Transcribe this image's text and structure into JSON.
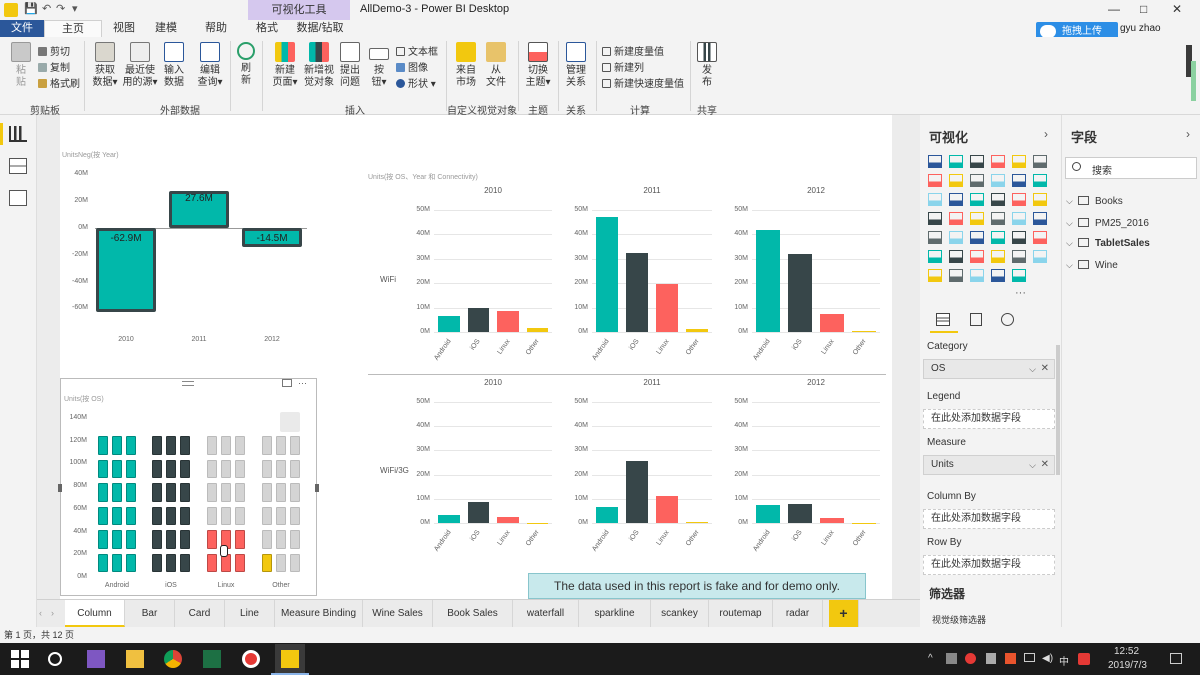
{
  "window": {
    "title": "AllDemo-3 - Power BI Desktop",
    "context_tab": "可视化工具",
    "minimize": "—",
    "maximize": "□",
    "close": "✕"
  },
  "quick_access": [
    "💾",
    "↶",
    "↷",
    "▾"
  ],
  "upload_label": "拖拽上传",
  "user_name": "gyu zhao",
  "tabs": [
    "文件",
    "主页",
    "视图",
    "建模",
    "帮助",
    "格式",
    "数据/钻取"
  ],
  "ribbon": {
    "paste": "粘\n贴",
    "cut": "剪切",
    "copy": "复制",
    "format_painter": "格式刷",
    "get_data": "获取\n数据▾",
    "recent": "最近使\n用的源▾",
    "enter_data": "输入\n数据",
    "edit_queries": "编辑\n查询▾",
    "refresh": "刷\n新",
    "new_page": "新建\n页面▾",
    "new_visual": "新增视\n觉对象",
    "ask": "提出\n问题",
    "buttons": "按\n钮▾",
    "textbox": "文本框",
    "image": "图像",
    "shapes": "形状 ▾",
    "from_market": "来自\n市场",
    "from_file": "从\n文件",
    "switch_theme": "切换\n主题▾",
    "manage_rel": "管理\n关系",
    "new_measure": "新建度量值",
    "new_column": "新建列",
    "new_quick_measure": "新建快速度量值",
    "publish": "发\n布",
    "groups": [
      "剪贴板",
      "外部数据",
      "插入",
      "自定义视觉对象",
      "主题",
      "关系",
      "计算",
      "共享"
    ]
  },
  "chart1": {
    "title": "UnitsNeg(按 Year)",
    "y_ticks": [
      "40M",
      "20M",
      "0M",
      "-20M",
      "-40M",
      "-60M"
    ],
    "chart_data": {
      "type": "bar",
      "categories": [
        "2010",
        "2011",
        "2012"
      ],
      "values": [
        -62.9,
        27.6,
        -14.5
      ],
      "labels": [
        "-62.9M",
        "27.6M",
        "-14.5M"
      ],
      "ylim": [
        -70,
        45
      ],
      "color": "#01b8aa"
    }
  },
  "chart2": {
    "title": "Units(按 OS、Year 和 Connectivity)",
    "col_headers": [
      "2010",
      "2011",
      "2012"
    ],
    "row_labels": [
      "WiFi",
      "WiFi/3G"
    ],
    "y_ticks_wifi": [
      "50M",
      "40M",
      "30M",
      "20M",
      "10M",
      "0M"
    ],
    "y_ticks_3g": [
      "50M",
      "40M",
      "30M",
      "20M",
      "10M",
      "0M"
    ],
    "categories": [
      "Android",
      "iOS",
      "Linux",
      "Other"
    ],
    "colors": [
      "#01b8aa",
      "#374649",
      "#fd625e",
      "#f2c80f"
    ],
    "chart_data": {
      "type": "bar",
      "ylim": [
        0,
        50
      ],
      "categories": [
        "Android",
        "iOS",
        "Linux",
        "Other"
      ],
      "panels": [
        {
          "row": "WiFi",
          "year": "2010",
          "values": [
            6.5,
            10,
            8.5,
            1.8
          ]
        },
        {
          "row": "WiFi",
          "year": "2011",
          "values": [
            47,
            32.5,
            19.5,
            1.2
          ]
        },
        {
          "row": "WiFi",
          "year": "2012",
          "values": [
            42,
            32,
            7.5,
            0.3
          ]
        },
        {
          "row": "WiFi/3G",
          "year": "2010",
          "values": [
            3.5,
            8.5,
            2.5,
            0.1
          ]
        },
        {
          "row": "WiFi/3G",
          "year": "2011",
          "values": [
            6.5,
            25.5,
            11,
            0.3
          ]
        },
        {
          "row": "WiFi/3G",
          "year": "2012",
          "values": [
            7.5,
            8,
            2,
            0.1
          ]
        }
      ]
    }
  },
  "chart3": {
    "title": "Units(按 OS)",
    "y_ticks": [
      "140M",
      "120M",
      "100M",
      "80M",
      "60M",
      "40M",
      "20M",
      "0M"
    ],
    "chart_data": {
      "type": "bar",
      "categories": [
        "Android",
        "iOS",
        "Linux",
        "Other"
      ],
      "values": [
        121,
        121,
        42,
        8
      ],
      "ylim": [
        0,
        140
      ],
      "colors": [
        "#01b8aa",
        "#374649",
        "#fd625e",
        "#f2c80f"
      ]
    }
  },
  "notice": "The data used in this report is fake and for demo only.",
  "viz_pane": {
    "title": "可视化",
    "wells": [
      {
        "label": "Category",
        "value": "OS",
        "filled": true
      },
      {
        "label": "Legend",
        "value": "在此处添加数据字段",
        "filled": false
      },
      {
        "label": "Measure",
        "value": "Units",
        "filled": true
      },
      {
        "label": "Column By",
        "value": "在此处添加数据字段",
        "filled": false
      },
      {
        "label": "Row By",
        "value": "在此处添加数据字段",
        "filled": false
      }
    ],
    "filters_title": "筛选器",
    "visual_filters": "视觉级筛选器"
  },
  "fields_pane": {
    "title": "字段",
    "search_placeholder": "搜索",
    "tables": [
      "Books",
      "PM25_2016",
      "TabletSales",
      "Wine"
    ]
  },
  "page_tabs": [
    "Column",
    "Bar",
    "Card",
    "Line",
    "Measure Binding",
    "Wine Sales",
    "Book Sales",
    "waterfall",
    "sparkline",
    "scankey",
    "routemap",
    "radar"
  ],
  "add_page": "+",
  "status": "第 1 页，共 12 页",
  "taskbar": {
    "time": "12:52",
    "date": "2019/7/3",
    "ime": "中"
  }
}
